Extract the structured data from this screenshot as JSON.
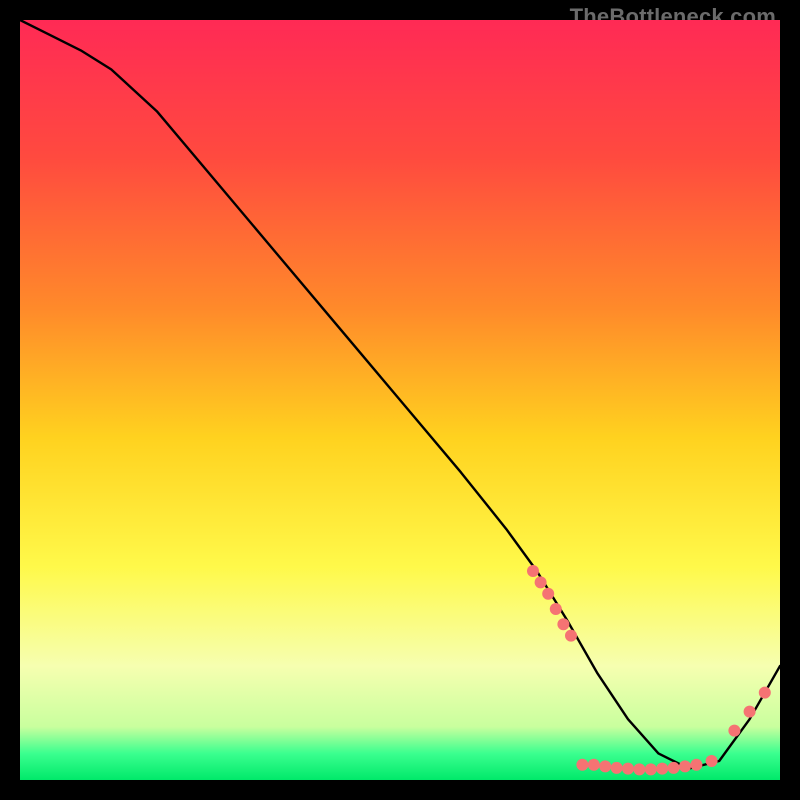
{
  "watermark": "TheBottleneck.com",
  "chart_data": {
    "type": "line",
    "title": "",
    "xlabel": "",
    "ylabel": "",
    "xlim": [
      0,
      100
    ],
    "ylim": [
      0,
      100
    ],
    "background_gradient": {
      "stops": [
        {
          "offset": 0.0,
          "color": "#ff2a55"
        },
        {
          "offset": 0.18,
          "color": "#ff4a3f"
        },
        {
          "offset": 0.38,
          "color": "#ff8a2a"
        },
        {
          "offset": 0.55,
          "color": "#ffd21f"
        },
        {
          "offset": 0.72,
          "color": "#fff94a"
        },
        {
          "offset": 0.85,
          "color": "#f6ffb0"
        },
        {
          "offset": 0.93,
          "color": "#c9ff9e"
        },
        {
          "offset": 0.965,
          "color": "#3bff8f"
        },
        {
          "offset": 1.0,
          "color": "#00e96a"
        }
      ]
    },
    "curve": {
      "x": [
        0,
        4,
        8,
        12,
        18,
        26,
        34,
        42,
        50,
        58,
        64,
        68,
        72,
        76,
        80,
        84,
        88,
        92,
        96,
        100
      ],
      "y": [
        100,
        98,
        96,
        93.5,
        88,
        78.5,
        69,
        59.5,
        50,
        40.5,
        33,
        27.5,
        21,
        14,
        8,
        3.5,
        1.5,
        2.5,
        8,
        15
      ]
    },
    "marker_color": "#f57373",
    "markers": [
      {
        "x": 67.5,
        "y": 27.5
      },
      {
        "x": 68.5,
        "y": 26.0
      },
      {
        "x": 69.5,
        "y": 24.5
      },
      {
        "x": 70.5,
        "y": 22.5
      },
      {
        "x": 71.5,
        "y": 20.5
      },
      {
        "x": 72.5,
        "y": 19.0
      },
      {
        "x": 74.0,
        "y": 2.0
      },
      {
        "x": 75.5,
        "y": 2.0
      },
      {
        "x": 77.0,
        "y": 1.8
      },
      {
        "x": 78.5,
        "y": 1.6
      },
      {
        "x": 80.0,
        "y": 1.5
      },
      {
        "x": 81.5,
        "y": 1.4
      },
      {
        "x": 83.0,
        "y": 1.4
      },
      {
        "x": 84.5,
        "y": 1.5
      },
      {
        "x": 86.0,
        "y": 1.6
      },
      {
        "x": 87.5,
        "y": 1.8
      },
      {
        "x": 89.0,
        "y": 2.0
      },
      {
        "x": 91.0,
        "y": 2.5
      },
      {
        "x": 94.0,
        "y": 6.5
      },
      {
        "x": 96.0,
        "y": 9.0
      },
      {
        "x": 98.0,
        "y": 11.5
      }
    ]
  }
}
